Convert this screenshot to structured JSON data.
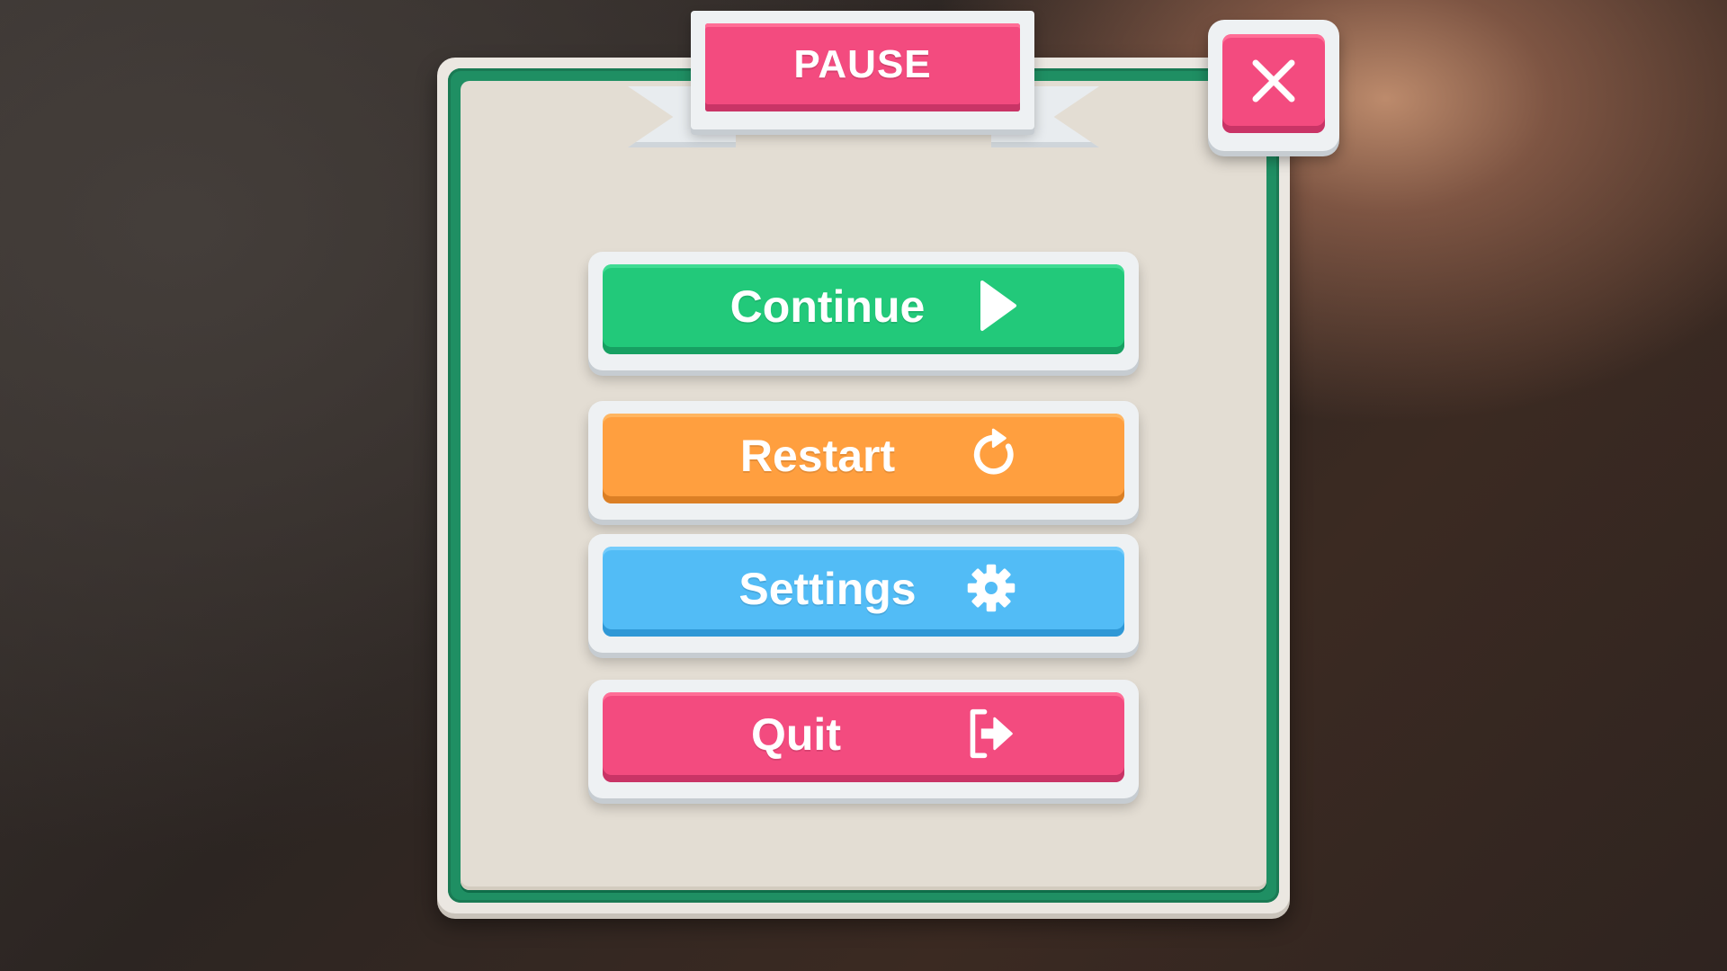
{
  "dialog": {
    "title": "PAUSE",
    "close_icon": "close-icon"
  },
  "buttons": [
    {
      "id": "continue",
      "label": "Continue",
      "icon": "play-icon",
      "color": "#22c97a"
    },
    {
      "id": "restart",
      "label": "Restart",
      "icon": "restart-icon",
      "color": "#ff9f3f"
    },
    {
      "id": "settings",
      "label": "Settings",
      "icon": "gear-icon",
      "color": "#52bcf6"
    },
    {
      "id": "quit",
      "label": "Quit",
      "icon": "exit-icon",
      "color": "#f34b7f"
    }
  ],
  "colors": {
    "panel_border": "#1f8f63",
    "panel_fill": "#e3ddd3",
    "accent_pink": "#f34b7f"
  }
}
